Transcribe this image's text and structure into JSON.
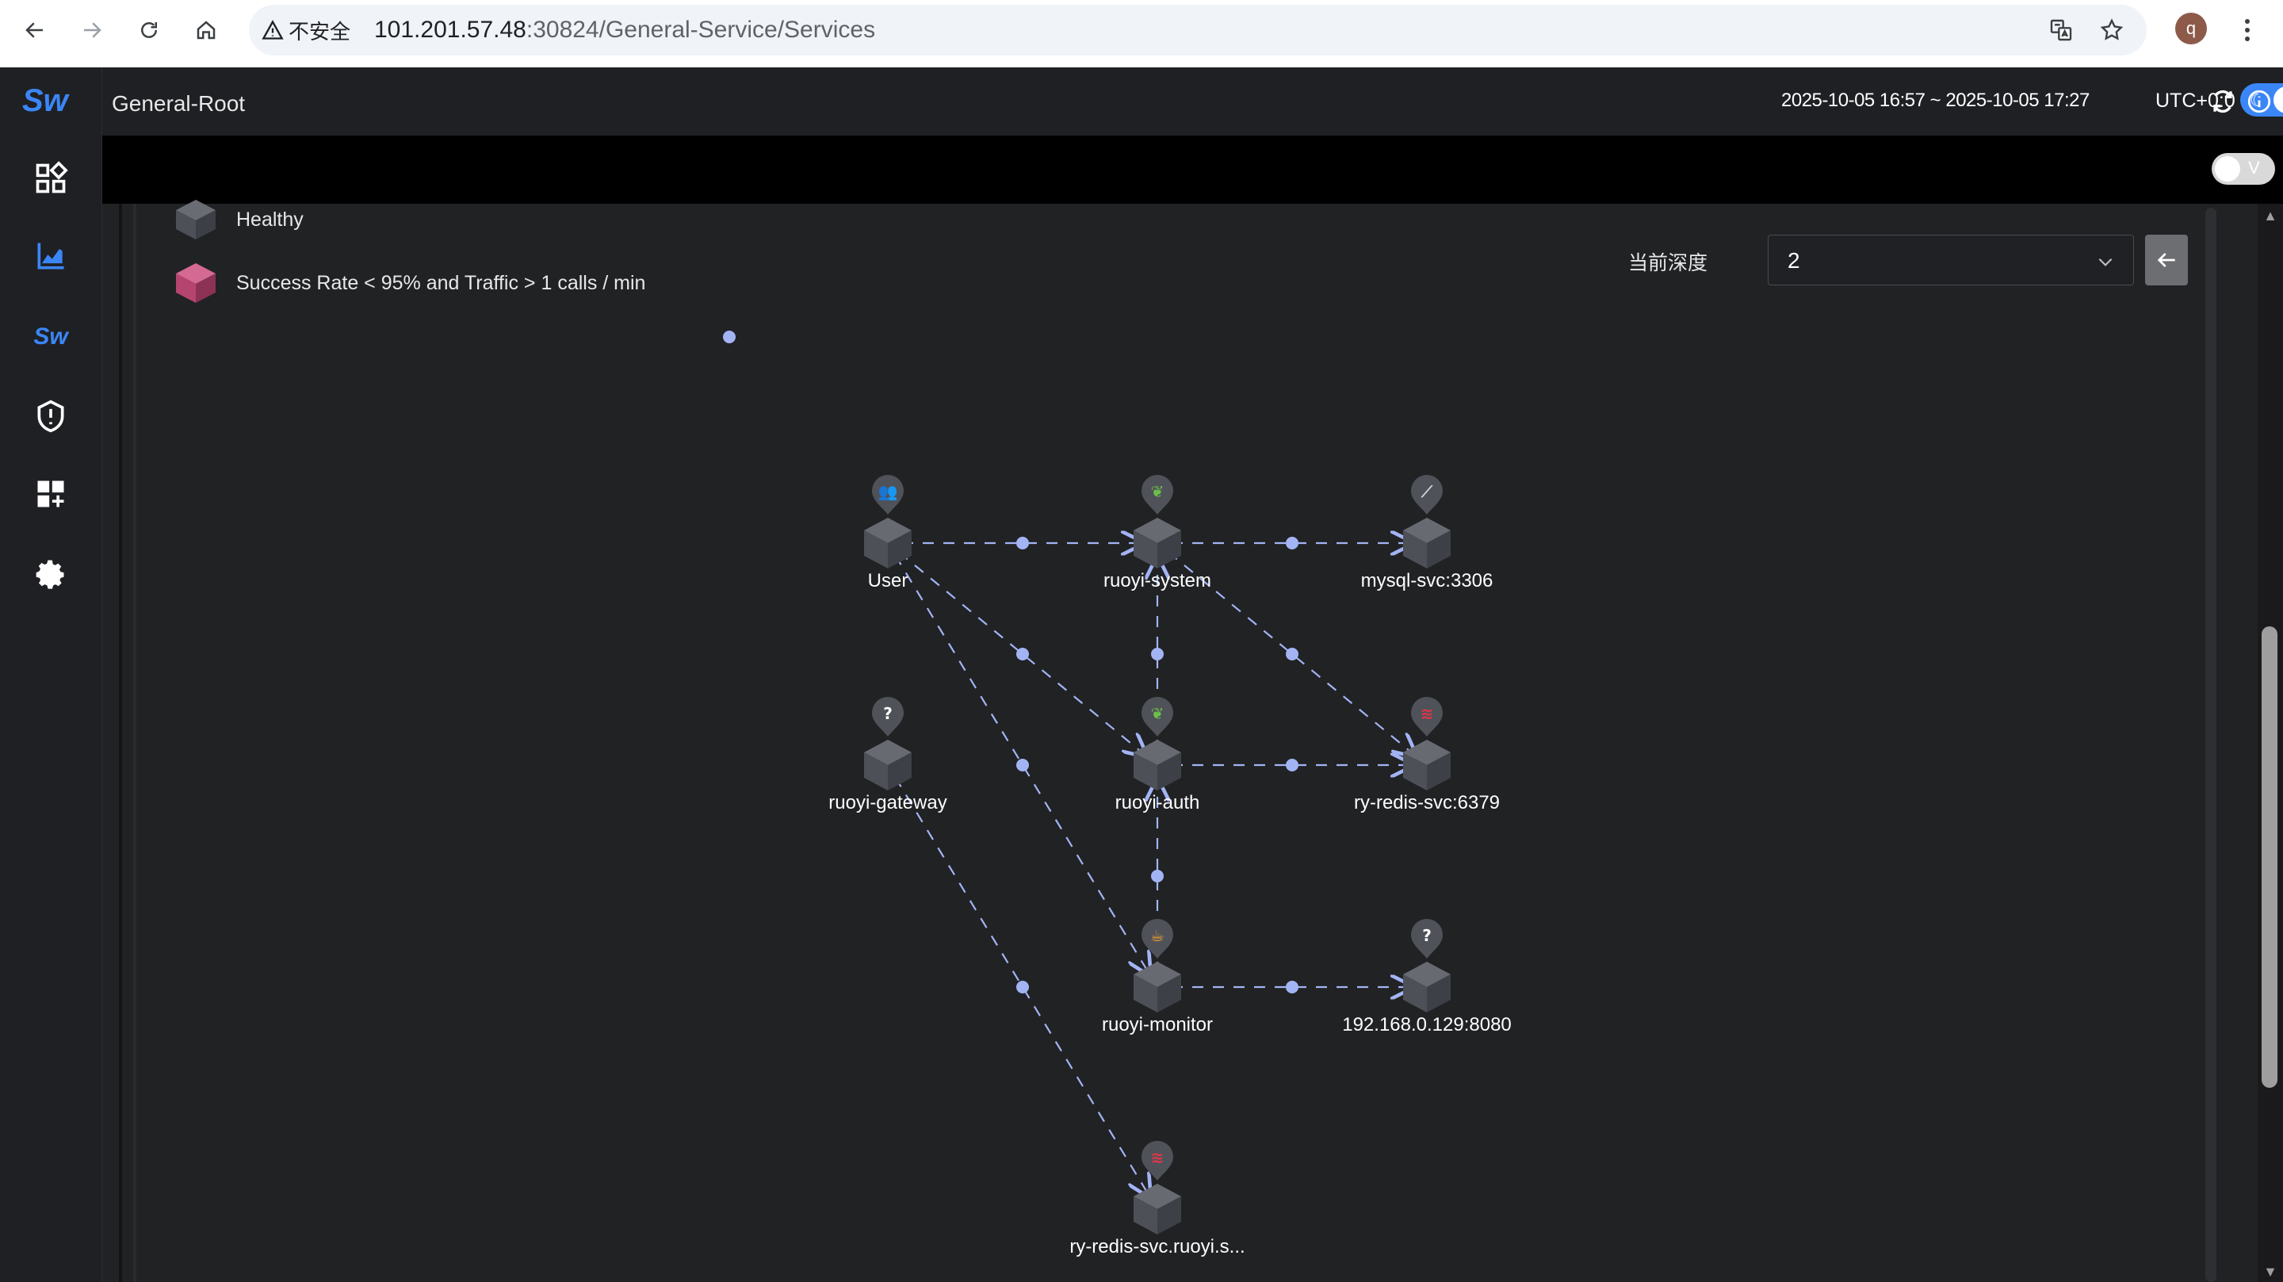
{
  "browser": {
    "security_label": "不安全",
    "url_host": "101.201.57.48",
    "url_path": ":30824/General-Service/Services",
    "profile_initial": "q"
  },
  "app": {
    "title": "General-Root",
    "time_range": "2025-10-05 16:57 ~ 2025-10-05 17:27",
    "timezone": "UTC+0:0",
    "v_toggle_label": "V"
  },
  "sidebar": {
    "logo": "Sw",
    "items": [
      {
        "name": "dashboard-icon"
      },
      {
        "name": "chart-icon"
      },
      {
        "name": "skywalking-icon"
      },
      {
        "name": "alert-icon"
      },
      {
        "name": "add-dashboard-icon"
      },
      {
        "name": "settings-icon"
      }
    ]
  },
  "legend": [
    {
      "label": "Healthy",
      "color": "#4e5058"
    },
    {
      "label": "Success Rate < 95% and Traffic > 1 calls / min",
      "color": "#b5456e"
    }
  ],
  "depth": {
    "label": "当前深度",
    "value": "2"
  },
  "topology": {
    "nodes": [
      {
        "id": "user",
        "label": "User",
        "icon": "user"
      },
      {
        "id": "system",
        "label": "ruoyi-system",
        "icon": "spring"
      },
      {
        "id": "mysql",
        "label": "mysql-svc:3306",
        "icon": "mysql"
      },
      {
        "id": "gateway",
        "label": "ruoyi-gateway",
        "icon": "unknown"
      },
      {
        "id": "auth",
        "label": "ruoyi-auth",
        "icon": "spring"
      },
      {
        "id": "redis1",
        "label": "ry-redis-svc:6379",
        "icon": "redis"
      },
      {
        "id": "monitor",
        "label": "ruoyi-monitor",
        "icon": "java"
      },
      {
        "id": "ip",
        "label": "192.168.0.129:8080",
        "icon": "unknown"
      },
      {
        "id": "redis2",
        "label": "ry-redis-svc.ruoyi.s...",
        "icon": "redis"
      }
    ],
    "edges": [
      {
        "from": "user",
        "to": "system"
      },
      {
        "from": "system",
        "to": "mysql"
      },
      {
        "from": "user",
        "to": "auth"
      },
      {
        "from": "user",
        "to": "monitor"
      },
      {
        "from": "system",
        "to": "redis1"
      },
      {
        "from": "auth",
        "to": "system"
      },
      {
        "from": "auth",
        "to": "redis1"
      },
      {
        "from": "monitor",
        "to": "auth"
      },
      {
        "from": "monitor",
        "to": "ip"
      },
      {
        "from": "gateway",
        "to": "redis2"
      }
    ],
    "colors": {
      "edge": "#a3b4f5",
      "cube": "#4e5058",
      "pin": "#505259"
    }
  }
}
